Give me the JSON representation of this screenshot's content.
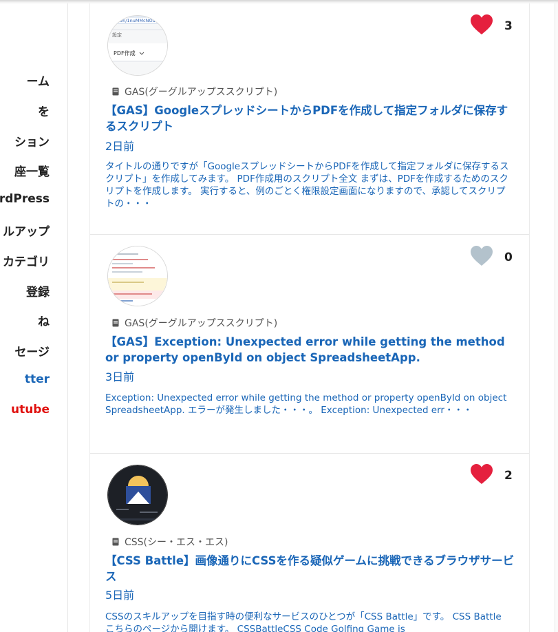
{
  "sidebar": {
    "items": [
      {
        "label": "ーム"
      },
      {
        "label": "を"
      },
      {
        "label": "ション"
      },
      {
        "label": "座一覧"
      },
      {
        "label": "rdPress"
      },
      {
        "label": "ルアップ"
      },
      {
        "label": "カテゴリ"
      },
      {
        "label": "登録"
      },
      {
        "label": "ね"
      },
      {
        "label": "セージ"
      },
      {
        "label": "tter"
      },
      {
        "label": "utube"
      }
    ]
  },
  "colors": {
    "link": "#1a66b7",
    "heart_liked": "#e5203e",
    "heart_unliked": "#b3c2cc",
    "youtube": "#e0100e"
  },
  "posts": [
    {
      "thumbnail": {
        "icon": "pdf-settings-screenshot",
        "url_snippet": "9n/1nuMMcNOa...",
        "caption1": "設定",
        "caption2": "PDF作成"
      },
      "likes": "3",
      "liked": true,
      "category": "GAS(グーグルアップススクリプト)",
      "title": "【GAS】GoogleスプレッドシートからPDFを作成して指定フォルダに保存するスクリプト",
      "date": "2日前",
      "excerpt": "タイトルの通りですが「GoogleスプレッドシートからPDFを作成して指定フォルダに保存するスクリプト」を作成してみます。 PDF作成用のスクリプト全文 まずは、PDFを作成するためのスクリプトを作成します。 実行すると、例のごとく権限設定画面になりますので、承認してスクリプトの・・・"
    },
    {
      "thumbnail": {
        "icon": "error-log-screenshot"
      },
      "likes": "0",
      "liked": false,
      "category": "GAS(グーグルアップススクリプト)",
      "title": "【GAS】Exception: Unexpected error while getting the method or property openById on object SpreadsheetApp.",
      "date": "3日前",
      "excerpt": "Exception: Unexpected error while getting the method or property openById on object SpreadsheetApp. エラーが発生しました・・・。 Exception: Unexpected err・・・"
    },
    {
      "thumbnail": {
        "icon": "css-battle-screenshot"
      },
      "likes": "2",
      "liked": true,
      "category": "CSS(シー・エス・エス)",
      "title": "【CSS Battle】画像通りにCSSを作る疑似ゲームに挑戦できるブラウザサービス",
      "date": "5日前",
      "excerpt": "CSSのスキルアップを目指す時の便利なサービスのひとつが「CSS Battle」です。 CSS Battle こちらのページから開けます。 CSSBattleCSS Code Golfing Game is"
    }
  ]
}
